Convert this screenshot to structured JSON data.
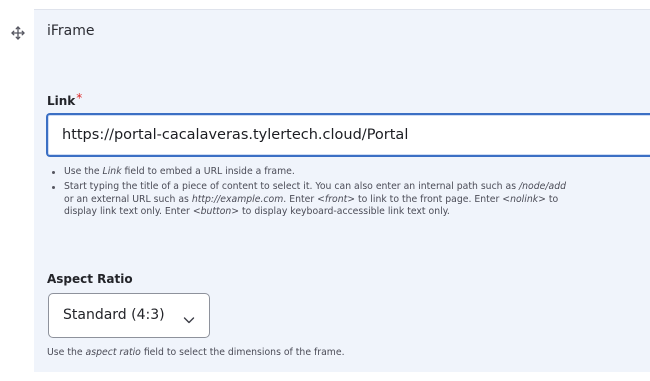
{
  "paragraph": {
    "title": "iFrame"
  },
  "link_field": {
    "label": "Link",
    "required_mark": "*",
    "value": "https://portal-cacalaveras.tylertech.cloud/Portal",
    "help": [
      {
        "a": "Use the ",
        "em1": "Link",
        "b": " field to embed a URL inside a frame."
      },
      {
        "a": "Start typing the title of a piece of content to select it. You can also enter an internal path such as ",
        "em1": "/node/add",
        "b": " or an external URL such as ",
        "em2": "http://example.com",
        "c": ". Enter ",
        "em3": "<front>",
        "d": " to link to the front page. Enter ",
        "em4": "<nolink>",
        "e": " to display link text only. Enter ",
        "em5": "<button>",
        "f": " to display keyboard-accessible link text only."
      }
    ]
  },
  "aspect_ratio": {
    "label": "Aspect Ratio",
    "selected": "Standard (4:3)",
    "help_a": "Use the ",
    "help_em": "aspect ratio",
    "help_b": " field to select the dimensions of the frame."
  },
  "icons": {
    "drag": "move-icon",
    "select": "chevron-down-icon"
  },
  "colors": {
    "panel_bg": "#f0f4fb",
    "focus_border": "#3b6fc4",
    "required": "#dc2323"
  }
}
